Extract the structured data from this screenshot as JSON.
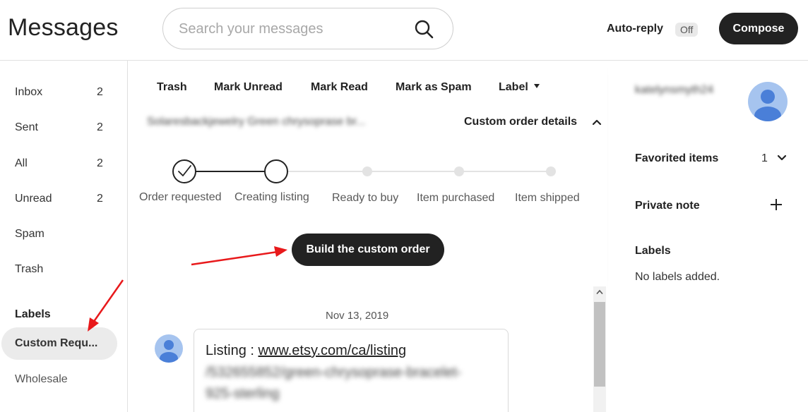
{
  "header": {
    "title": "Messages",
    "search_placeholder": "Search your messages",
    "autoreply_label": "Auto-reply",
    "autoreply_state": "Off",
    "compose_label": "Compose"
  },
  "sidebar": {
    "items": [
      {
        "label": "Inbox",
        "count": "2"
      },
      {
        "label": "Sent",
        "count": "2"
      },
      {
        "label": "All",
        "count": "2"
      },
      {
        "label": "Unread",
        "count": "2"
      },
      {
        "label": "Spam",
        "count": ""
      },
      {
        "label": "Trash",
        "count": ""
      }
    ],
    "labels_heading": "Labels",
    "labels": [
      {
        "label": "Custom Requ...",
        "selected": true
      },
      {
        "label": "Wholesale",
        "selected": false
      }
    ]
  },
  "toolbar": {
    "trash": "Trash",
    "mark_unread": "Mark Unread",
    "mark_read": "Mark Read",
    "mark_spam": "Mark as Spam",
    "label": "Label"
  },
  "conversation": {
    "subject_blurred": "Solaresbackjewelry Green chrysoprase br...",
    "custom_order_details": "Custom order details",
    "steps": [
      {
        "label": "Order requested",
        "state": "done"
      },
      {
        "label": "Creating listing",
        "state": "current"
      },
      {
        "label": "Ready to buy",
        "state": "pending"
      },
      {
        "label": "Item purchased",
        "state": "pending"
      },
      {
        "label": "Item shipped",
        "state": "pending"
      }
    ],
    "build_button": "Build the custom order",
    "date": "Nov 13, 2019",
    "message": {
      "prefix": "Listing : ",
      "link": "www.etsy.com/ca/listing",
      "blurred_line_1": "/532655852/green-chrysoprase-bracelet-",
      "blurred_line_2": "925-sterling"
    }
  },
  "right_panel": {
    "username_blurred": "katelynsmyth24",
    "favorited_items_label": "Favorited items",
    "favorited_count": "1",
    "private_note_label": "Private note",
    "labels_heading": "Labels",
    "no_labels_text": "No labels added."
  },
  "colors": {
    "primary_button": "#222222",
    "avatar": "#a6c4ef",
    "avatar_figure": "#4a7fd8",
    "annotation_arrow": "#e8191b",
    "selected_label_bg": "#ebebeb"
  }
}
